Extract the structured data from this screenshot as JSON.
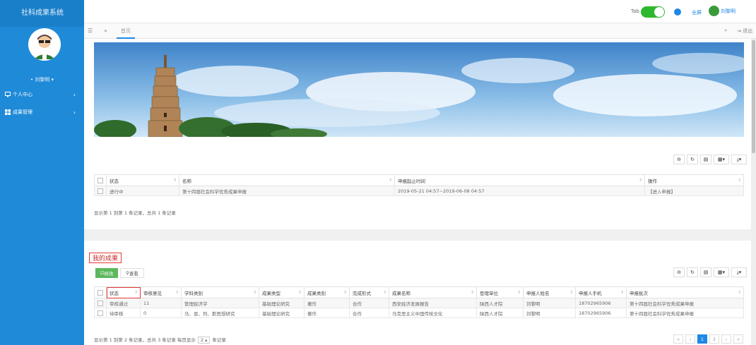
{
  "app": {
    "title": "社科成果系统"
  },
  "sidebar": {
    "username": "• 刘黎明 ▾",
    "items": [
      {
        "label": "个人中心",
        "icon": "monitor-icon"
      },
      {
        "label": "成果管理",
        "icon": "grid-icon"
      }
    ]
  },
  "header": {
    "tab_label": "Tab",
    "fullscreen": "全屏",
    "user": "刘黎明"
  },
  "tabbar": {
    "home_tab": "首页",
    "logout": "退出"
  },
  "declare_table": {
    "columns": [
      "状态",
      "名称",
      "申报起止时间",
      "操作"
    ],
    "rows": [
      {
        "status": "进行中",
        "name": "第十四届社会科学优秀成果申报",
        "period": "2019-05-21 04:57~2019-06-08 04:57",
        "action": "【进入申报】"
      }
    ],
    "summary": "显示第 1 到第 1 条记录，总共 1 条记录"
  },
  "achievements": {
    "title": "我的成果",
    "edit_button": "修改",
    "view_button": "查看",
    "columns": [
      "状态",
      "审核意见",
      "学科类别",
      "成果类型",
      "成果类别",
      "完成形式",
      "成果名称",
      "登理单位",
      "申报人姓名",
      "申报人手机",
      "申报批次"
    ],
    "rows": [
      {
        "status": "审核通过",
        "opinion": "11",
        "subject": "管理经济学",
        "type": "基础理论研究",
        "category": "著作",
        "form": "合作",
        "name": "西安经济发展报告",
        "unit": "陕西人才院",
        "person": "刘黎明",
        "phone": "18702965906",
        "batch": "第十四届社会科学优秀成果申报"
      },
      {
        "status": "待审核",
        "opinion": "0",
        "subject": "马、恩、列、斯思想研究",
        "type": "基础理论研究",
        "category": "著作",
        "form": "合作",
        "name": "马克思主义中国传统文化",
        "unit": "陕西人才院",
        "person": "刘黎明",
        "phone": "18702965906",
        "batch": "第十四届社会科学优秀成果申报"
      }
    ],
    "summary_prefix": "显示第 1 到第 2 条记录，总共 3 条记录 每页显示",
    "page_size": "2 ▴",
    "summary_suffix": "条记录",
    "pager": [
      "«",
      "‹",
      "1",
      "2",
      "›",
      "»"
    ]
  },
  "colors": {
    "sidebar": "#1f8ad8",
    "accent": "#1e88e5",
    "success": "#5cb85c",
    "highlight": "#e53935"
  }
}
